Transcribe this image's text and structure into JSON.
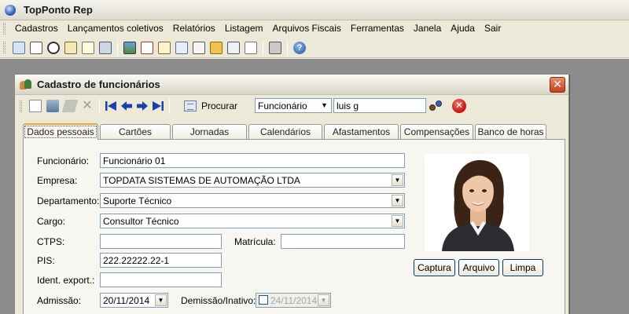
{
  "app": {
    "title": "TopPonto Rep"
  },
  "menu": [
    {
      "label": "Cadastros"
    },
    {
      "label": "Lançamentos coletivos"
    },
    {
      "label": "Relatórios"
    },
    {
      "label": "Listagem"
    },
    {
      "label": "Arquivos Fiscais"
    },
    {
      "label": "Ferramentas"
    },
    {
      "label": "Janela"
    },
    {
      "label": "Ajuda"
    },
    {
      "label": "Sair"
    }
  ],
  "window": {
    "title": "Cadastro de funcionários",
    "toolbar": {
      "search_label": "Procurar",
      "search_field": "Funcionário",
      "search_value": "luis g"
    },
    "tabs": [
      {
        "label": "Dados pessoais",
        "active": true
      },
      {
        "label": "Cartões"
      },
      {
        "label": "Jornadas"
      },
      {
        "label": "Calendários"
      },
      {
        "label": "Afastamentos"
      },
      {
        "label": "Compensações"
      },
      {
        "label": "Banco de horas"
      }
    ]
  },
  "form": {
    "funcionario": {
      "label": "Funcionário:",
      "value": "Funcionário 01"
    },
    "empresa": {
      "label": "Empresa:",
      "value": "TOPDATA SISTEMAS DE AUTOMAÇÃO LTDA"
    },
    "departamento": {
      "label": "Departamento:",
      "value": "Suporte Técnico"
    },
    "cargo": {
      "label": "Cargo:",
      "value": "Consultor Técnico"
    },
    "ctps": {
      "label": "CTPS:",
      "value": ""
    },
    "matricula": {
      "label": "Matrícula:",
      "value": ""
    },
    "pis": {
      "label": "PIS:",
      "value": "222.22222.22-1"
    },
    "ident_export": {
      "label": "Ident. export.:",
      "value": ""
    },
    "admissao": {
      "label": "Admissão:",
      "value": "20/11/2014"
    },
    "demissao": {
      "label": "Demissão/Inativo:",
      "value": "24/11/2014"
    }
  },
  "photo_buttons": {
    "capture": "Captura",
    "file": "Arquivo",
    "clear": "Limpa"
  }
}
